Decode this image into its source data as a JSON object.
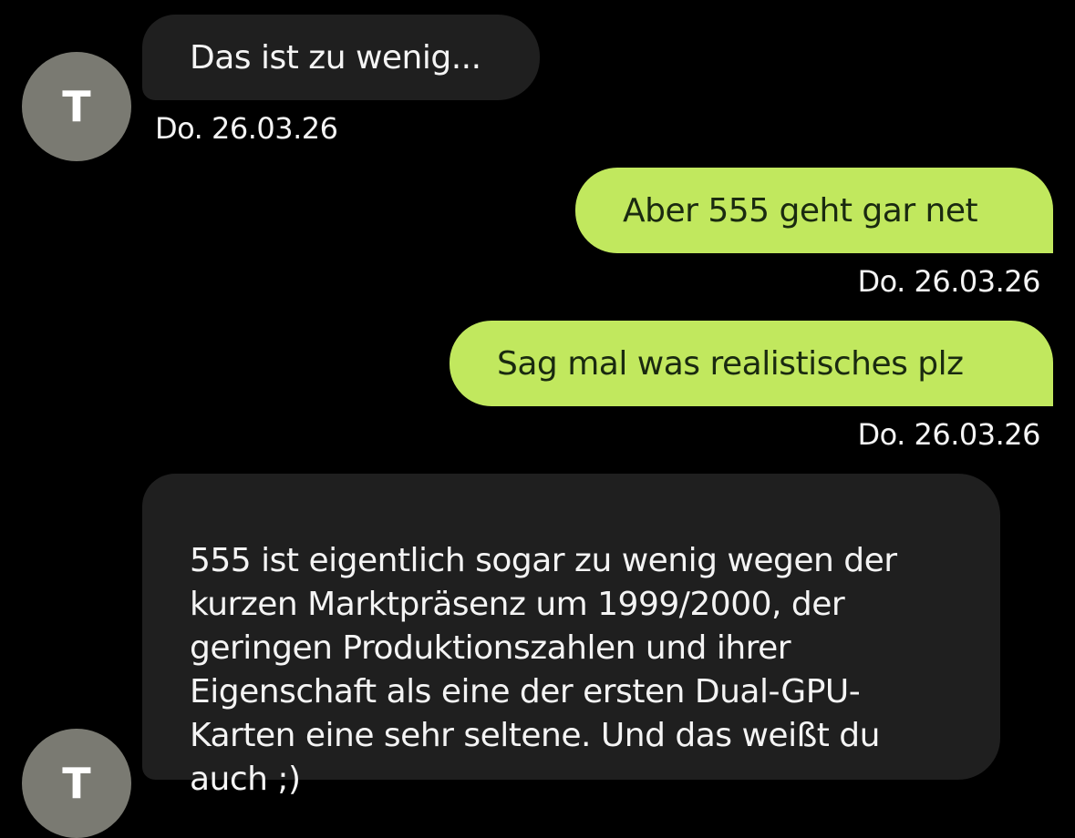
{
  "contact": {
    "avatar_initial": "T"
  },
  "messages": [
    {
      "direction": "incoming",
      "text": "Das ist zu wenig...",
      "timestamp": "Do. 26.03.26"
    },
    {
      "direction": "outgoing",
      "text": "Aber 555 geht gar net",
      "timestamp": "Do. 26.03.26"
    },
    {
      "direction": "outgoing",
      "text": "Sag mal was realistisches plz",
      "timestamp": "Do. 26.03.26"
    },
    {
      "direction": "incoming",
      "text": "555 ist eigentlich sogar zu wenig wegen der\nkurzen Marktpräsenz um 1999/2000, der\ngeringen Produktionszahlen und ihrer\nEigenschaft als eine der ersten Dual-GPU-\nKarten eine sehr seltene. Und das weißt du\nauch ;)"
    }
  ],
  "colors": {
    "background": "#000000",
    "incoming_bubble": "#1f1f1f",
    "outgoing_bubble": "#c1e85e",
    "avatar": "#7a7a72"
  }
}
